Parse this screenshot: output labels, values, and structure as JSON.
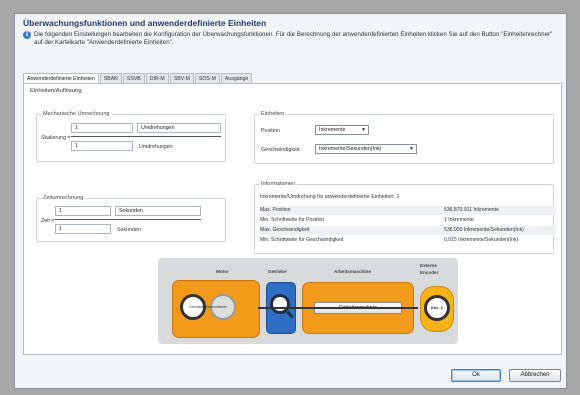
{
  "dialog": {
    "title": "Überwachungsfunktionen und anwenderdefinierte Einheiten",
    "description": "Die folgenden Einstellungen bearbeiten die Konfiguration der Überwachungsfunktionen. Für die Berechnung der anwenderdefinierten Einheiten klicken Sie auf den Button \"Einheitenrechner\" auf der Karteikarte \"Anwenderdefinierte Einheiten\"."
  },
  "tabs": [
    {
      "label": "Anwenderdefinierte Einheiten",
      "active": true
    },
    {
      "label": "SBAR"
    },
    {
      "label": "SSVB"
    },
    {
      "label": "DIR-M"
    },
    {
      "label": "SBV-M"
    },
    {
      "label": "SOS-M"
    },
    {
      "label": "Ausgänge"
    }
  ],
  "section_title": "Einheiten/Auflösung",
  "mech": {
    "title": "Mechanische Umrechnung",
    "label": "Skalierung =",
    "num_value": "1",
    "num_unit": "Umdrehungen",
    "den_value": "1",
    "den_unit": "Umdrehungen"
  },
  "time": {
    "title": "Zeitumrechnung",
    "label": "Zeit =",
    "num_value": "1",
    "num_unit": "Sekunden",
    "den_value": "1",
    "den_unit": "Sekunden"
  },
  "units": {
    "title": "Einheiten",
    "position_label": "Position",
    "position_value": "Inkremente",
    "speed_label": "Geschwindigkeit",
    "speed_value": "Inkremente/Sekunden(Ink)"
  },
  "info": {
    "title": "Informationen",
    "header": "Inkremente/Umdrehung für anwenderdefinierte Einheiten: 1",
    "rows": [
      {
        "key": "Max. Position",
        "value": "536.870.911 Inkremente"
      },
      {
        "key": "Min. Schrittweite für Position",
        "value": "1 Inkremente"
      },
      {
        "key": "Max. Geschwindigkeit",
        "value": "536.000 Inkremente/Sekunden(Ink)"
      },
      {
        "key": "Min. Schrittweite für Geschwindigkeit",
        "value": "0,015 Inkremente/Sekunden(Ink)"
      }
    ]
  },
  "diagram": {
    "motor_label": "Motor",
    "gear_label": "Getriebe",
    "machine_label": "Arbeitsmaschine",
    "encoder_label_1": "Externe",
    "encoder_label_2": "Encoder",
    "calculator_button": "Einheitenrechner",
    "motor_encoder_text": "Drehmomentschnittstelle",
    "encoder_text": "Enc. 2",
    "colors": {
      "block": "#f39a1d",
      "gear": "#3f7fd0",
      "encoder": "#f6b21a"
    }
  },
  "footer": {
    "ok_label": "Ok",
    "cancel_label": "Abbrechen"
  }
}
